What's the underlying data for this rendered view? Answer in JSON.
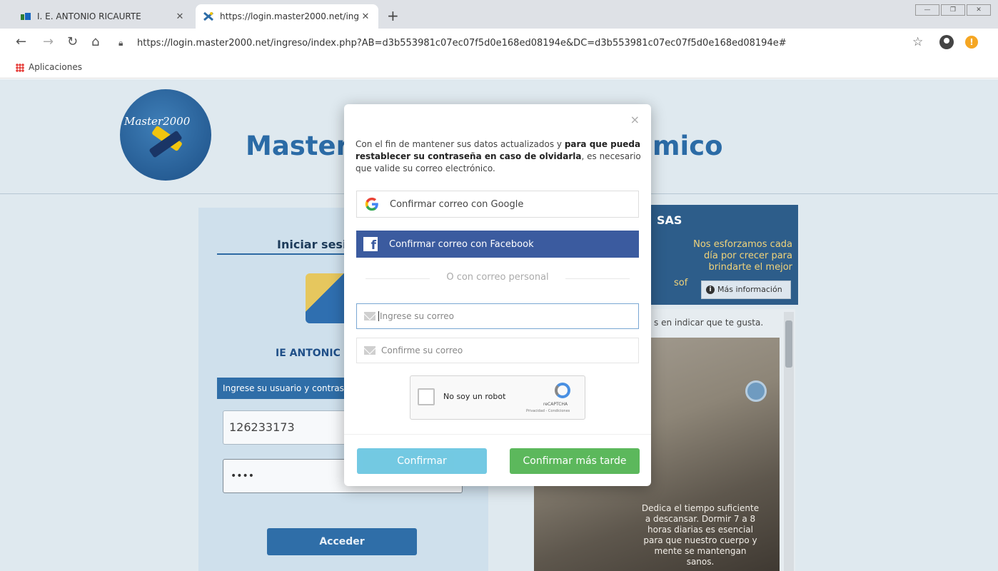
{
  "browser": {
    "tabs": [
      {
        "title": "I. E. ANTONIO RICAURTE",
        "active": false
      },
      {
        "title": "https://login.master2000.net/ing",
        "active": true
      }
    ],
    "address": "https://login.master2000.net/ingreso/index.php?AB=d3b553981c07ec07f5d0e168ed08194e&DC=d3b553981c07ec07f5d0e168ed08194e#",
    "bookmarks": [
      "Aplicaciones"
    ],
    "update_badge": "!"
  },
  "page": {
    "logo_text": "Master2000",
    "title_left": "Master",
    "title_right": "mico",
    "login": {
      "heading": "Iniciar sesi",
      "school": "IE ANTONIC",
      "instructions": "Ingrese su usuario y contras",
      "username": "126233173",
      "password": "••••",
      "submit": "Acceder"
    },
    "side": {
      "company": "SAS",
      "slogan": "Nos esforzamos cada día por crecer para brindarte el mejor",
      "slogan_end": "sof",
      "more_info": "Más información"
    },
    "feed": {
      "like_text": "s en indicar que te gusta.",
      "image_text": "Dedica el tiempo suficiente a descansar. Dormir 7 a 8 horas diarias es esencial para que nuestro cuerpo y mente se mantengan sanos."
    }
  },
  "modal": {
    "close": "×",
    "message_pre": "Con el fin de mantener sus datos actualizados y ",
    "message_bold": "para que pueda restablecer su contraseña en caso de olvidarla",
    "message_post": ", es necesario que valide su correo electrónico.",
    "google_button": "Confirmar correo con Google",
    "facebook_button": "Confirmar correo con Facebook",
    "divider": "O con correo personal",
    "email_placeholder": "Ingrese su correo",
    "email_confirm_placeholder": "Confirme su correo",
    "captcha": {
      "label": "No soy un robot",
      "brand": "reCAPTCHA",
      "terms": "Privacidad - Condiciones"
    },
    "confirm_button": "Confirmar",
    "later_button": "Confirmar más tarde"
  },
  "colors": {
    "facebook": "#3b5b9f",
    "confirm": "#5bc0de",
    "later": "#5cb85c",
    "brand_blue": "#2b6ba6"
  }
}
